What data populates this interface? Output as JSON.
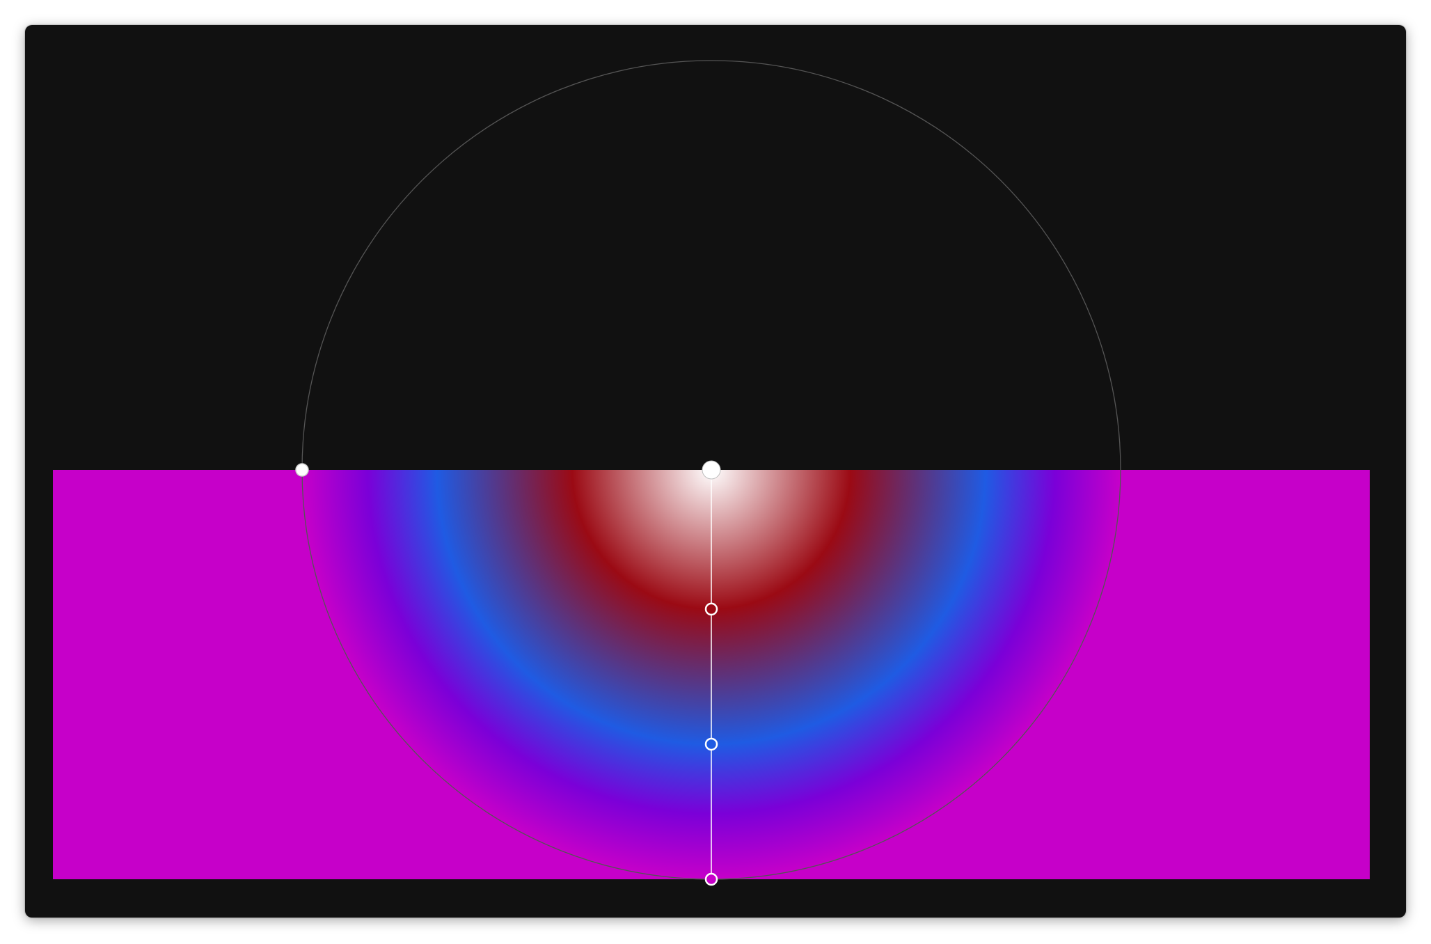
{
  "gradient": {
    "type": "radial",
    "background_fill": "#c600c9",
    "stops": [
      {
        "color": "#ffffff",
        "position": 0.0
      },
      {
        "color": "#9b0a14",
        "position": 0.34
      },
      {
        "color": "#1f5be3",
        "position": 0.67
      },
      {
        "color": "#7b00d8",
        "position": 0.84
      },
      {
        "color": "#c600c9",
        "position": 1.0
      }
    ],
    "stop_handles": [
      {
        "name": "stop-handle-start",
        "color": "#ffffff",
        "position": 0.0
      },
      {
        "name": "stop-handle-red",
        "color": "#9b0a14",
        "position": 0.34
      },
      {
        "name": "stop-handle-blue",
        "color": "#1f5be3",
        "position": 0.67
      },
      {
        "name": "stop-handle-end",
        "color": "#c600c9",
        "position": 1.0
      }
    ]
  },
  "colors": {
    "canvas": "#111111",
    "guide_circle": "#555555",
    "handle_fill": "#ffffff",
    "axis_line": "#ffffff"
  }
}
